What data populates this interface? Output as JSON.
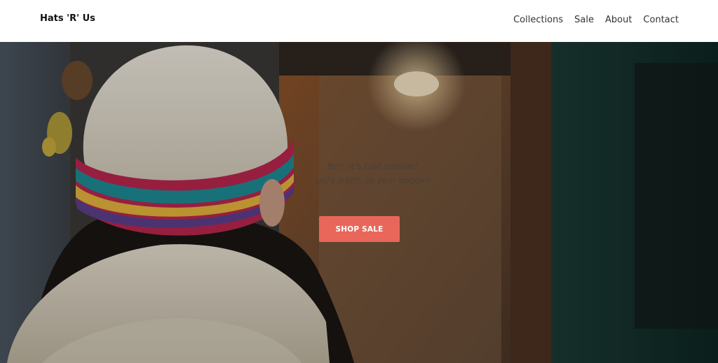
{
  "header": {
    "logo": "Hats 'R' Us",
    "nav": [
      "Collections",
      "Sale",
      "About",
      "Contact"
    ]
  },
  "hero": {
    "line1": "Brrr, it's cold outside!",
    "line2": "Let's warm up your noggin!",
    "button_label": "SHOP SALE"
  },
  "colors": {
    "accent": "#e8675a",
    "header_bg": "#ffffff",
    "hero_dark": "#2e2f2c"
  }
}
